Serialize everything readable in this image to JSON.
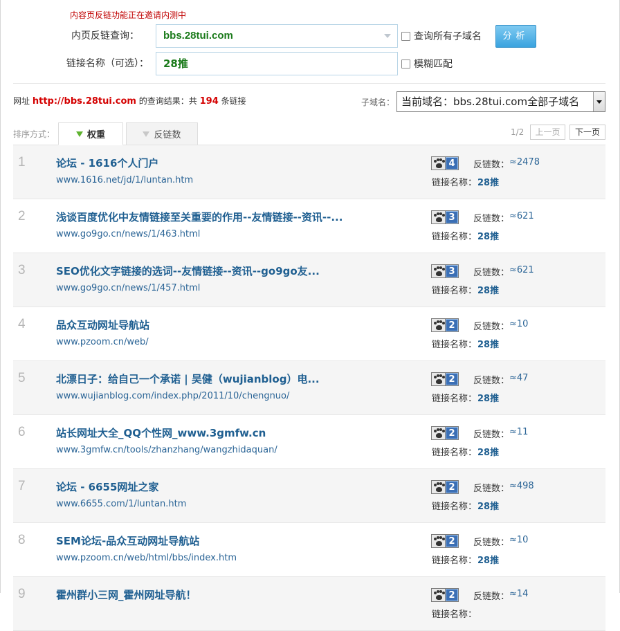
{
  "form": {
    "notice": "内容页反链功能正在邀请内测中",
    "url_label": "内页反链查询：",
    "url_value": "bbs.28tui.com",
    "name_label": "链接名称（可选）：",
    "name_value": "28推",
    "subdomain_checkbox": "查询所有子域名",
    "fuzzy_checkbox": "模糊匹配",
    "analyze_button": "分析"
  },
  "summary": {
    "prefix": "网址",
    "url": "http://bbs.28tui.com",
    "middle": "的查询结果：共",
    "count": "194",
    "suffix": "条链接",
    "subdomain_label": "子域名：",
    "subdomain_selected": "当前域名：bbs.28tui.com全部子域名"
  },
  "sort": {
    "label": "排序方式：",
    "tab_weight": "权重",
    "tab_backlinks": "反链数"
  },
  "pager": {
    "info": "1/2",
    "prev": "上一页",
    "next": "下一页"
  },
  "labels": {
    "backlinks": "反链数：",
    "link_name": "链接名称："
  },
  "results": [
    {
      "rank": "1",
      "title": "论坛 - 1616个人门户",
      "url": "www.1616.net/jd/1/luntan.htm",
      "weight": "4",
      "backlinks": "≈2478",
      "link_name": "28推"
    },
    {
      "rank": "2",
      "title": "浅谈百度优化中友情链接至关重要的作用--友情链接--资讯--...",
      "url": "www.go9go.cn/news/1/463.html",
      "weight": "3",
      "backlinks": "≈621",
      "link_name": "28推"
    },
    {
      "rank": "3",
      "title": "SEO优化文字链接的选词--友情链接--资讯--go9go友...",
      "url": "www.go9go.cn/news/1/457.html",
      "weight": "3",
      "backlinks": "≈621",
      "link_name": "28推"
    },
    {
      "rank": "4",
      "title": "品众互动网址导航站",
      "url": "www.pzoom.cn/web/",
      "weight": "2",
      "backlinks": "≈10",
      "link_name": "28推"
    },
    {
      "rank": "5",
      "title": "北漂日子：给自己一个承诺 | 吴健（wujianblog）电...",
      "url": "www.wujianblog.com/index.php/2011/10/chengnuo/",
      "weight": "2",
      "backlinks": "≈47",
      "link_name": "28推"
    },
    {
      "rank": "6",
      "title": "站长网址大全_QQ个性网_www.3gmfw.cn",
      "url": "www.3gmfw.cn/tools/zhanzhang/wangzhidaquan/",
      "weight": "2",
      "backlinks": "≈11",
      "link_name": "28推"
    },
    {
      "rank": "7",
      "title": "论坛 - 6655网址之家",
      "url": "www.6655.com/1/luntan.htm",
      "weight": "2",
      "backlinks": "≈498",
      "link_name": "28推"
    },
    {
      "rank": "8",
      "title": "SEM论坛-品众互动网址导航站",
      "url": "www.pzoom.cn/web/html/bbs/index.htm",
      "weight": "2",
      "backlinks": "≈10",
      "link_name": "28推"
    },
    {
      "rank": "9",
      "title": "霍州群小三网_霍州网址导航！",
      "url": "",
      "weight": "2",
      "backlinks": "≈14",
      "link_name": ""
    }
  ]
}
